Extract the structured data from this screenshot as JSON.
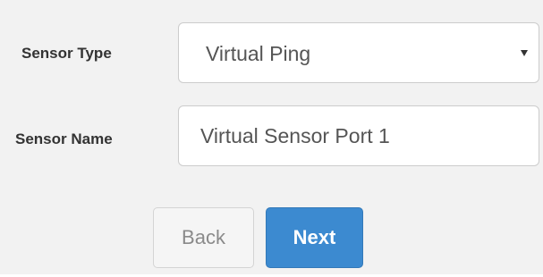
{
  "form": {
    "sensor_type": {
      "label": "Sensor Type",
      "selected": "Virtual Ping",
      "icon": "caret-down-icon"
    },
    "sensor_name": {
      "label": "Sensor Name",
      "value": "Virtual Sensor Port 1"
    }
  },
  "actions": {
    "back_label": "Back",
    "next_label": "Next"
  },
  "colors": {
    "panel_background": "#f2f2f2",
    "primary": "#3c8ad0",
    "default_button": "#f5f5f5"
  }
}
